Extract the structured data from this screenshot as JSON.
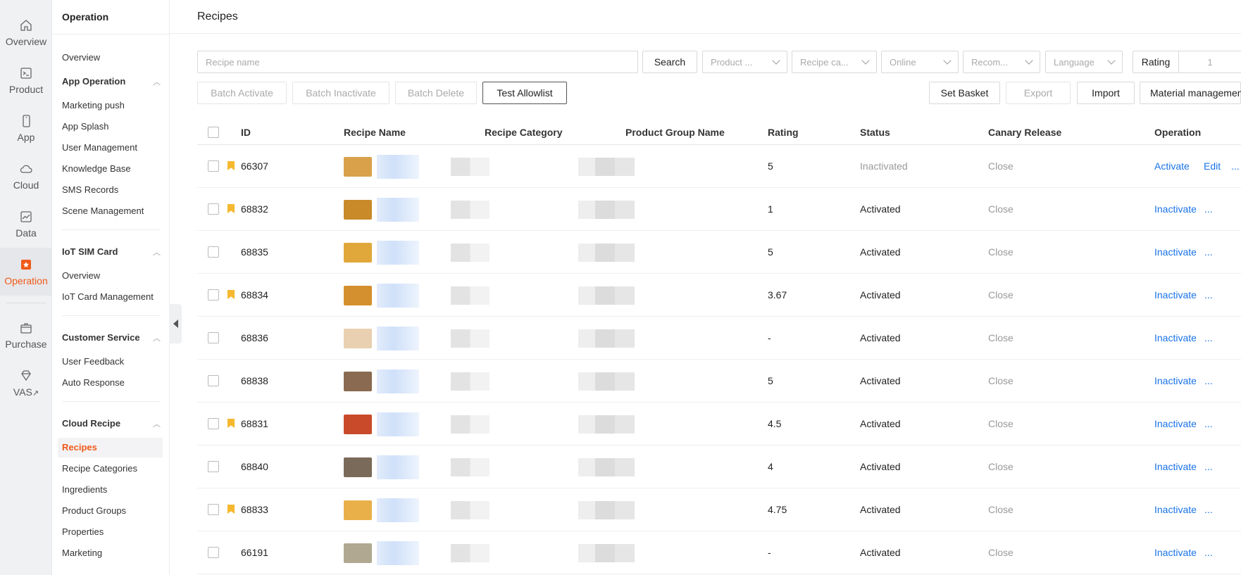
{
  "rail": {
    "items": [
      {
        "label": "Overview",
        "icon": "home-icon"
      },
      {
        "label": "Product",
        "icon": "terminal-icon"
      },
      {
        "label": "App",
        "icon": "phone-icon"
      },
      {
        "label": "Cloud",
        "icon": "cloud-icon"
      },
      {
        "label": "Data",
        "icon": "chart-icon"
      },
      {
        "label": "Operation",
        "icon": "operation-icon"
      },
      {
        "label": "Purchase",
        "icon": "box-icon"
      },
      {
        "label": "VAS",
        "icon": "diamond-icon"
      }
    ],
    "vas_suffix": "↗",
    "active_color": "#f05a1a"
  },
  "subnav": {
    "title": "Operation",
    "overview": "Overview",
    "app_operation": {
      "label": "App Operation",
      "items": [
        "Marketing push",
        "App Splash",
        "User Management",
        "Knowledge Base",
        "SMS Records",
        "Scene Management"
      ]
    },
    "iot_sim": {
      "label": "IoT SIM Card",
      "items": [
        "Overview",
        "IoT Card Management"
      ]
    },
    "customer_service": {
      "label": "Customer Service",
      "items": [
        "User Feedback",
        "Auto Response"
      ]
    },
    "cloud_recipe": {
      "label": "Cloud Recipe",
      "items": [
        "Recipes",
        "Recipe Categories",
        "Ingredients",
        "Product Groups",
        "Properties",
        "Marketing"
      ]
    }
  },
  "page": {
    "title": "Recipes"
  },
  "filters": {
    "search_placeholder": "Recipe name",
    "search_button": "Search",
    "product": "Product ...",
    "recipe_category": "Recipe ca...",
    "online": "Online",
    "recommend": "Recom...",
    "language": "Language",
    "rating_label": "Rating",
    "rating_value": "1"
  },
  "actions": {
    "batch_activate": "Batch Activate",
    "batch_inactivate": "Batch Inactivate",
    "batch_delete": "Batch Delete",
    "test_allowlist": "Test Allowlist",
    "set_basket": "Set Basket",
    "export": "Export",
    "import": "Import",
    "material_management": "Material management"
  },
  "table": {
    "columns": [
      "ID",
      "Recipe Name",
      "Recipe Category",
      "Product Group Name",
      "Rating",
      "Status",
      "Canary Release",
      "Operation"
    ],
    "rows": [
      {
        "id": "66307",
        "bookmark": true,
        "rating": "5",
        "status": "Inactivated",
        "canary": "Close",
        "op": "Activate",
        "edit": "Edit",
        "more": "..."
      },
      {
        "id": "68832",
        "bookmark": true,
        "rating": "1",
        "status": "Activated",
        "canary": "Close",
        "op": "Inactivate",
        "more": "..."
      },
      {
        "id": "68835",
        "bookmark": false,
        "rating": "5",
        "status": "Activated",
        "canary": "Close",
        "op": "Inactivate",
        "more": "..."
      },
      {
        "id": "68834",
        "bookmark": true,
        "rating": "3.67",
        "status": "Activated",
        "canary": "Close",
        "op": "Inactivate",
        "more": "..."
      },
      {
        "id": "68836",
        "bookmark": false,
        "rating": "-",
        "status": "Activated",
        "canary": "Close",
        "op": "Inactivate",
        "more": "..."
      },
      {
        "id": "68838",
        "bookmark": false,
        "rating": "5",
        "status": "Activated",
        "canary": "Close",
        "op": "Inactivate",
        "more": "..."
      },
      {
        "id": "68831",
        "bookmark": true,
        "rating": "4.5",
        "status": "Activated",
        "canary": "Close",
        "op": "Inactivate",
        "more": "..."
      },
      {
        "id": "68840",
        "bookmark": false,
        "rating": "4",
        "status": "Activated",
        "canary": "Close",
        "op": "Inactivate",
        "more": "..."
      },
      {
        "id": "68833",
        "bookmark": true,
        "rating": "4.75",
        "status": "Activated",
        "canary": "Close",
        "op": "Inactivate",
        "more": "..."
      },
      {
        "id": "66191",
        "bookmark": false,
        "rating": "-",
        "status": "Activated",
        "canary": "Close",
        "op": "Inactivate",
        "more": "..."
      }
    ]
  },
  "colors": {
    "accent": "#f05a1a",
    "link": "#1a73e8",
    "bookmark": "#f5b82e"
  }
}
